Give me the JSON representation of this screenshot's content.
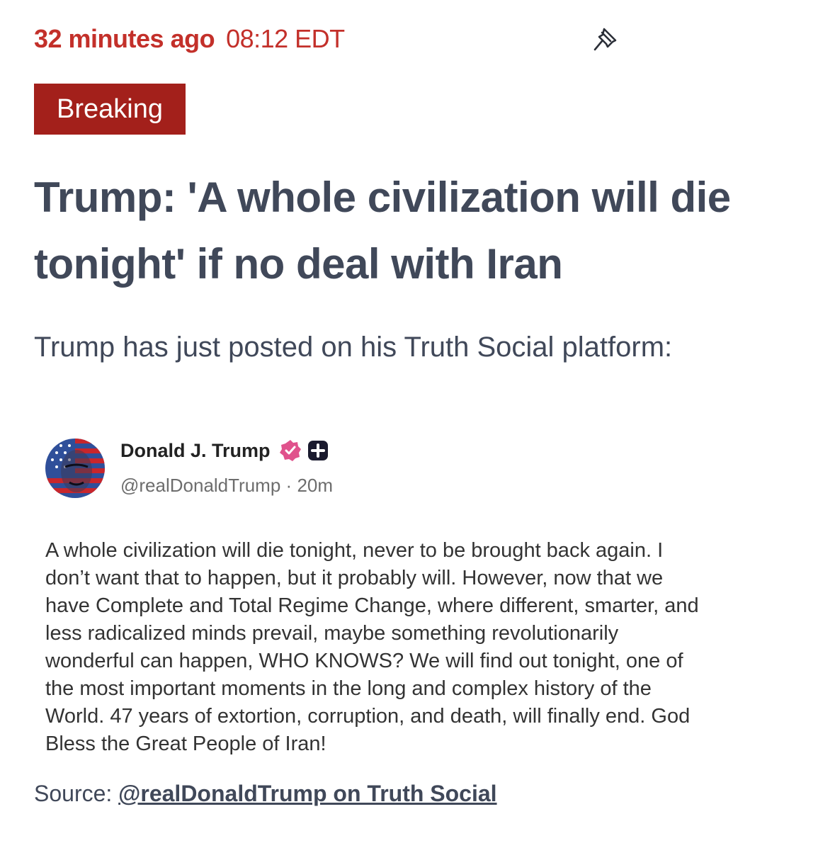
{
  "meta": {
    "time_ago": "32 minutes ago",
    "time_stamp": "08:12 EDT",
    "pin_icon": "pushpin-icon"
  },
  "badge": "Breaking",
  "headline": "Trump: 'A whole civilization will die tonight' if no deal with Iran",
  "intro": "Trump has just posted on his Truth Social platform:",
  "post": {
    "author": "Donald J. Trump",
    "handle": "@realDonaldTrump",
    "separator": "·",
    "age": "20m",
    "icons": [
      "verified-badge-icon",
      "plus-icon"
    ],
    "accent_color": "#e0528c",
    "body_lines": [
      "A whole civilization will die tonight, never to be brought back again. I",
      "don’t want that to happen, but it probably will. However, now that we",
      "have Complete and Total Regime Change, where different, smarter, and",
      "less radicalized minds prevail, maybe something revolutionarily",
      "wonderful can happen, WHO KNOWS? We will find out tonight, one of",
      "the most important moments in the long and complex history of the",
      "World. 47 years of extortion, corruption, and death, will finally end. God",
      "Bless the Great People of Iran!"
    ]
  },
  "source": {
    "label": "Source:",
    "link_text": "@realDonaldTrump on Truth Social"
  },
  "colors": {
    "accent": "#c3302a",
    "badge_bg": "#a3201b",
    "text": "#404859"
  }
}
